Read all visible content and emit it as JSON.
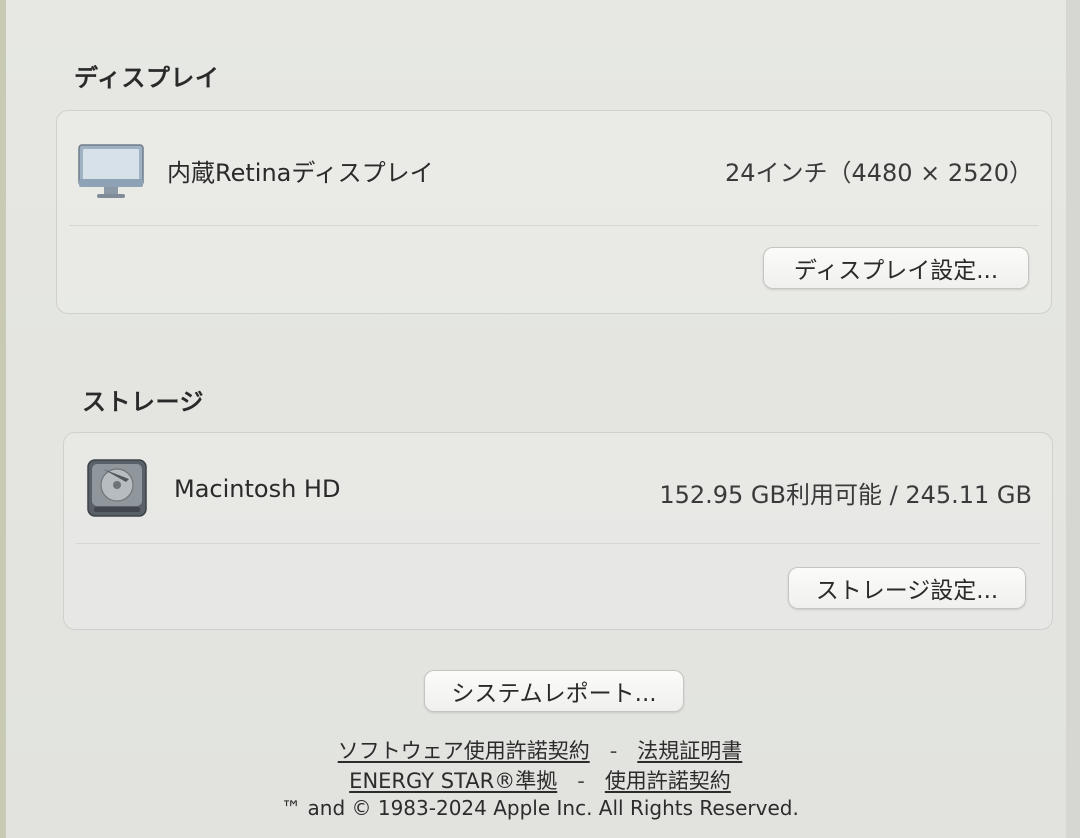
{
  "display_section": {
    "title": "ディスプレイ",
    "item_name": "内蔵Retinaディスプレイ",
    "item_value": "24インチ（4480 × 2520）",
    "settings_button": "ディスプレイ設定..."
  },
  "storage_section": {
    "title": "ストレージ",
    "item_name": "Macintosh HD",
    "item_value": "152.95 GB利用可能 / 245.11 GB",
    "settings_button": "ストレージ設定..."
  },
  "system_report_button": "システムレポート...",
  "footer": {
    "link_software_license": "ソフトウェア使用許諾契約",
    "link_regulatory": "法規証明書",
    "link_energy_star": "ENERGY STAR®準拠",
    "link_license": "使用許諾契約",
    "separator": "-",
    "copyright": "™ and © 1983-2024 Apple Inc. All Rights Reserved."
  },
  "icons": {
    "display": "display-icon",
    "disk": "hard-disk-icon"
  }
}
